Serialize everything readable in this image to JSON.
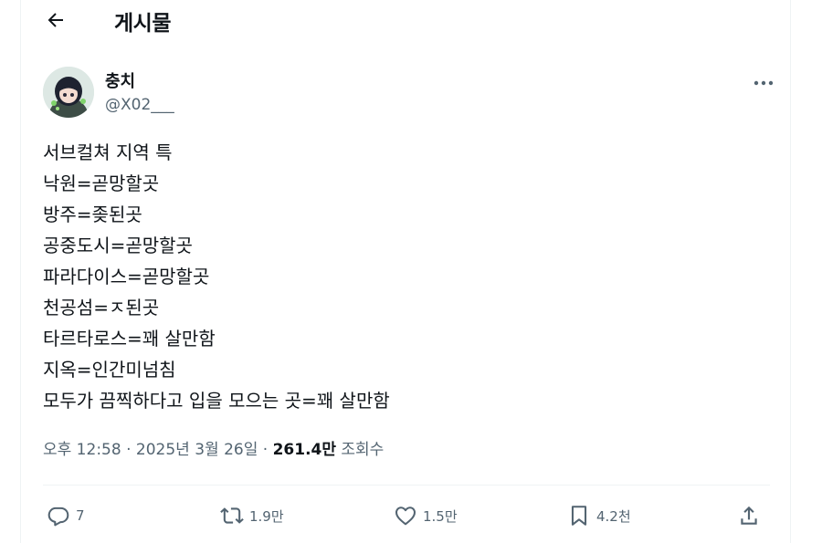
{
  "header": {
    "title": "게시물"
  },
  "author": {
    "display_name": "충치",
    "handle": "@X02___"
  },
  "tweet": {
    "lines": [
      "서브컬쳐 지역 특",
      "낙원=곧망할곳",
      "방주=좆된곳",
      "공중도시=곧망할곳",
      "파라다이스=곧망할곳",
      "천공섬=ㅈ된곳",
      "타르타로스=꽤 살만함",
      "지옥=인간미넘침",
      "모두가 끔찍하다고 입을 모으는 곳=꽤 살만함"
    ]
  },
  "meta": {
    "time": "오후 12:58",
    "sep1": " · ",
    "date": "2025년 3월 26일",
    "sep2": " · ",
    "views": "261.4만",
    "views_label": " 조회수"
  },
  "actions": {
    "replies": "7",
    "reposts": "1.9만",
    "likes": "1.5만",
    "bookmarks": "4.2천"
  },
  "icons": {
    "back": "arrow-left-icon",
    "more": "more-dots-icon",
    "reply": "speech-bubble-icon",
    "repost": "repost-icon",
    "like": "heart-icon",
    "bookmark": "bookmark-icon",
    "share": "share-icon"
  },
  "colors": {
    "text": "#0f1419",
    "secondary": "#536471",
    "border": "#eff3f4"
  }
}
